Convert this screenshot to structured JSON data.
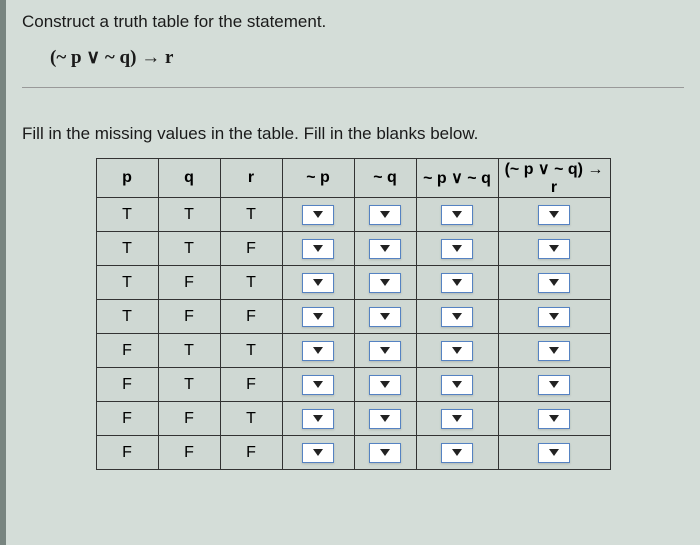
{
  "instruction": "Construct a truth table for the statement.",
  "expression": "(~ p ∨ ~ q) → r",
  "fill_instruction": "Fill in the missing values in the table. Fill in the blanks below.",
  "table": {
    "headers": {
      "p": "p",
      "q": "q",
      "r": "r",
      "not_p": "~ p",
      "not_q": "~ q",
      "or": "~ p ∨ ~ q",
      "imp": "(~ p ∨ ~ q) → r"
    },
    "rows": [
      {
        "p": "T",
        "q": "T",
        "r": "T"
      },
      {
        "p": "T",
        "q": "T",
        "r": "F"
      },
      {
        "p": "T",
        "q": "F",
        "r": "T"
      },
      {
        "p": "T",
        "q": "F",
        "r": "F"
      },
      {
        "p": "F",
        "q": "T",
        "r": "T"
      },
      {
        "p": "F",
        "q": "T",
        "r": "F"
      },
      {
        "p": "F",
        "q": "F",
        "r": "T"
      },
      {
        "p": "F",
        "q": "F",
        "r": "F"
      }
    ]
  }
}
